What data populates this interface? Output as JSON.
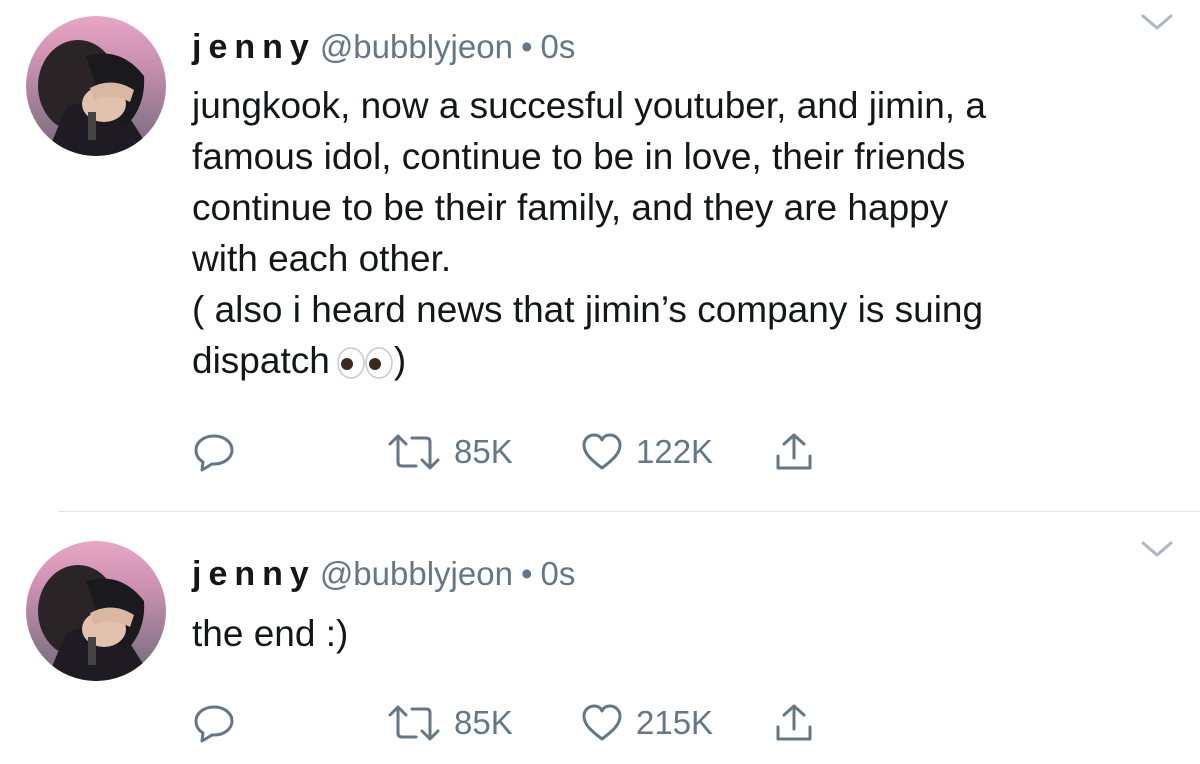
{
  "tweets": [
    {
      "display_name": "jenny",
      "handle": "@bubblyjeon",
      "separator": "•",
      "time": "0s",
      "text_lines": [
        "jungkook, now a succesful youtuber, and jimin, a",
        "famous idol, continue to be in love, their friends",
        "continue to be their family, and they are happy",
        "with each other.",
        "( also i heard news that jimin’s company is suing",
        "dispatch"
      ],
      "text_end": ")",
      "emoji": "eyes-emoji",
      "retweets": "85K",
      "likes": "122K"
    },
    {
      "display_name": "jenny",
      "handle": "@bubblyjeon",
      "separator": "•",
      "time": "0s",
      "text_lines": [
        "the end :)"
      ],
      "retweets": "85K",
      "likes": "215K"
    }
  ],
  "icons": {
    "reply": "reply-icon",
    "retweet": "retweet-icon",
    "like": "heart-icon",
    "share": "share-icon",
    "menu": "chevron-down-icon"
  },
  "colors": {
    "text": "#14171a",
    "secondary": "#657786",
    "divider": "#e1e8ed"
  }
}
